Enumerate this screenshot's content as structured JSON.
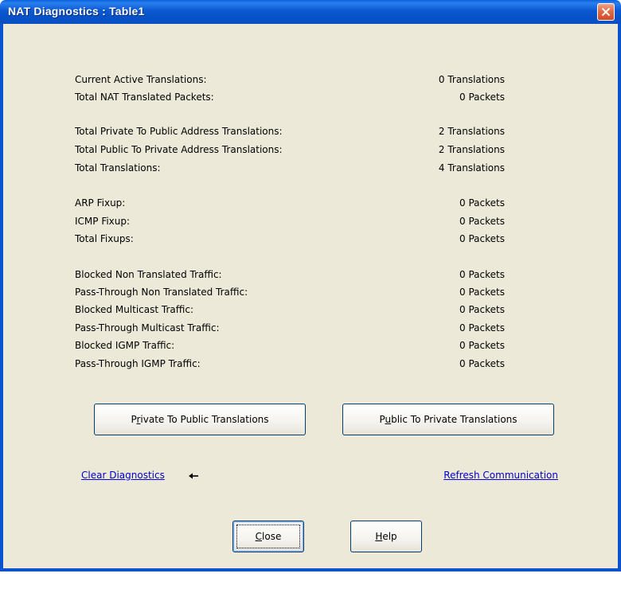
{
  "window": {
    "title": "NAT Diagnostics : Table1",
    "accent_color": "#0b52cf",
    "close_icon": "close-icon"
  },
  "stats": [
    {
      "label": "Current Active Translations:",
      "value": "0 Translations"
    },
    {
      "label": "Total NAT Translated Packets:",
      "value": "0 Packets"
    },
    {
      "label": "Total Private To Public Address Translations:",
      "value": "2 Translations"
    },
    {
      "label": "Total Public To Private Address Translations:",
      "value": "2 Translations"
    },
    {
      "label": "Total Translations:",
      "value": "4 Translations"
    },
    {
      "label": "ARP Fixup:",
      "value": "0 Packets"
    },
    {
      "label": "ICMP Fixup:",
      "value": "0 Packets"
    },
    {
      "label": "Total Fixups:",
      "value": "0 Packets"
    },
    {
      "label": "Blocked Non Translated Traffic:",
      "value": "0 Packets"
    },
    {
      "label": "Pass-Through Non Translated Traffic:",
      "value": "0 Packets"
    },
    {
      "label": "Blocked Multicast Traffic:",
      "value": "0 Packets"
    },
    {
      "label": "Pass-Through Multicast Traffic:",
      "value": "0 Packets"
    },
    {
      "label": "Blocked IGMP Traffic:",
      "value": "0 Packets"
    },
    {
      "label": "Pass-Through IGMP Traffic:",
      "value": "0 Packets"
    }
  ],
  "buttons": {
    "private_to_public": {
      "before": "P",
      "mnemonic": "r",
      "after": "ivate To Public Translations"
    },
    "public_to_private": {
      "before": "P",
      "mnemonic": "u",
      "after": "blic To Private Translations"
    },
    "close": {
      "before": "",
      "mnemonic": "C",
      "after": "lose"
    },
    "help": {
      "before": "",
      "mnemonic": "H",
      "after": "elp"
    }
  },
  "links": {
    "clear_diagnostics": "Clear Diagnostics",
    "refresh_communication": "Refresh Communication",
    "arrow_icon": "arrow-left-icon"
  }
}
